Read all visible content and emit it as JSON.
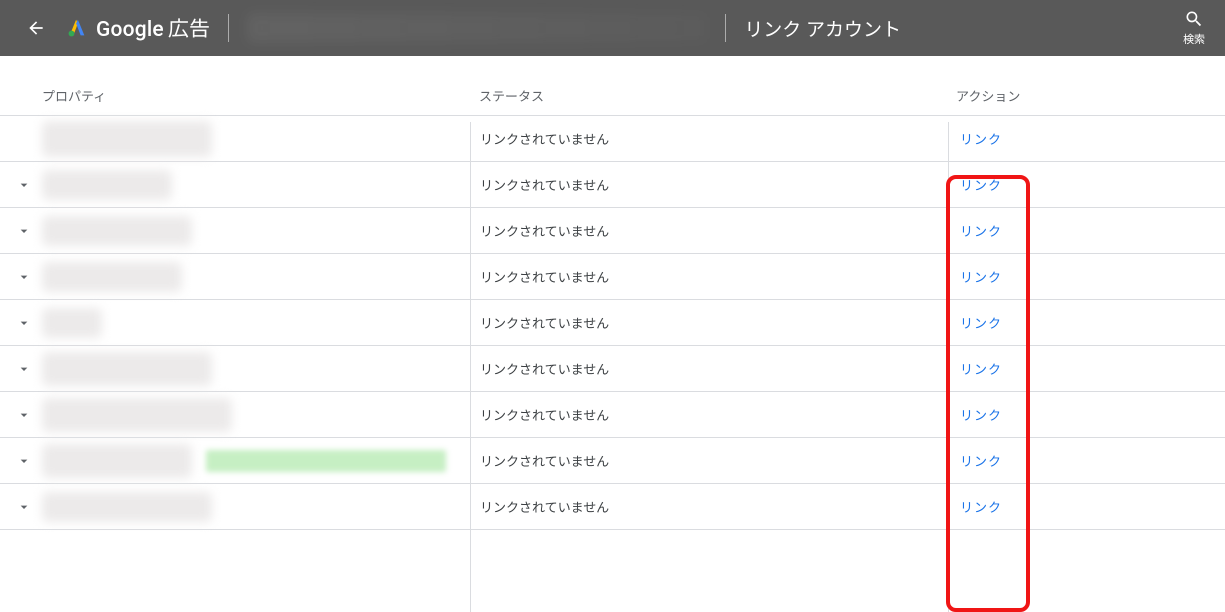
{
  "header": {
    "brand_google": "Google",
    "brand_ads": "広告",
    "page_title": "リンク アカウント",
    "search_label": "検索"
  },
  "table": {
    "columns": {
      "property": "プロパティ",
      "status": "ステータス",
      "action": "アクション"
    },
    "link_label": "リンク",
    "rows": [
      {
        "expandable": false,
        "blur_class": "w1",
        "status": "リンクされていません"
      },
      {
        "expandable": true,
        "blur_class": "w2",
        "status": "リンクされていません"
      },
      {
        "expandable": true,
        "blur_class": "w3",
        "status": "リンクされていません"
      },
      {
        "expandable": true,
        "blur_class": "w4",
        "status": "リンクされていません"
      },
      {
        "expandable": true,
        "blur_class": "w5",
        "status": "リンクされていません"
      },
      {
        "expandable": true,
        "blur_class": "w6",
        "status": "リンクされていません"
      },
      {
        "expandable": true,
        "blur_class": "w7",
        "status": "リンクされていません"
      },
      {
        "expandable": true,
        "blur_class": "w8",
        "status": "リンクされていません",
        "green": true
      },
      {
        "expandable": true,
        "blur_class": "w9",
        "status": "リンクされていません"
      }
    ]
  }
}
